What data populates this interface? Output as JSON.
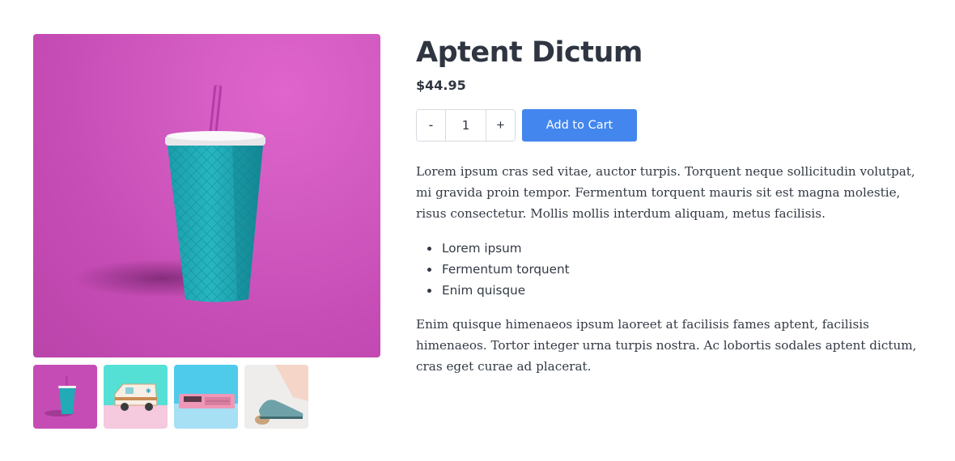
{
  "product": {
    "title": "Aptent Dictum",
    "price": "$44.95"
  },
  "quantity": {
    "decrement_label": "-",
    "value": "1",
    "increment_label": "+"
  },
  "add_to_cart_label": "Add to Cart",
  "description": "Lorem ipsum cras sed vitae, auctor turpis. Torquent neque sollicitudin volutpat, mi gravida proin tempor. Fermentum torquent mauris sit est magna molestie, risus consectetur. Mollis mollis interdum aliquam, metus facilisis.",
  "features": [
    "Lorem ipsum",
    "Fermentum torquent",
    "Enim quisque"
  ],
  "description_2": "Enim quisque himenaeos ipsum laoreet at facilisis fames aptent, facilisis himenaeos. Tortor integer urna turpis nostra. Ac lobortis sodales aptent dictum, cras eget curae ad placerat.",
  "gallery": {
    "main_image": "teal-cup-with-straw",
    "thumbnails": [
      "teal-cup-with-straw",
      "toy-ambulance",
      "pink-radio-clock",
      "blue-shoe"
    ]
  }
}
